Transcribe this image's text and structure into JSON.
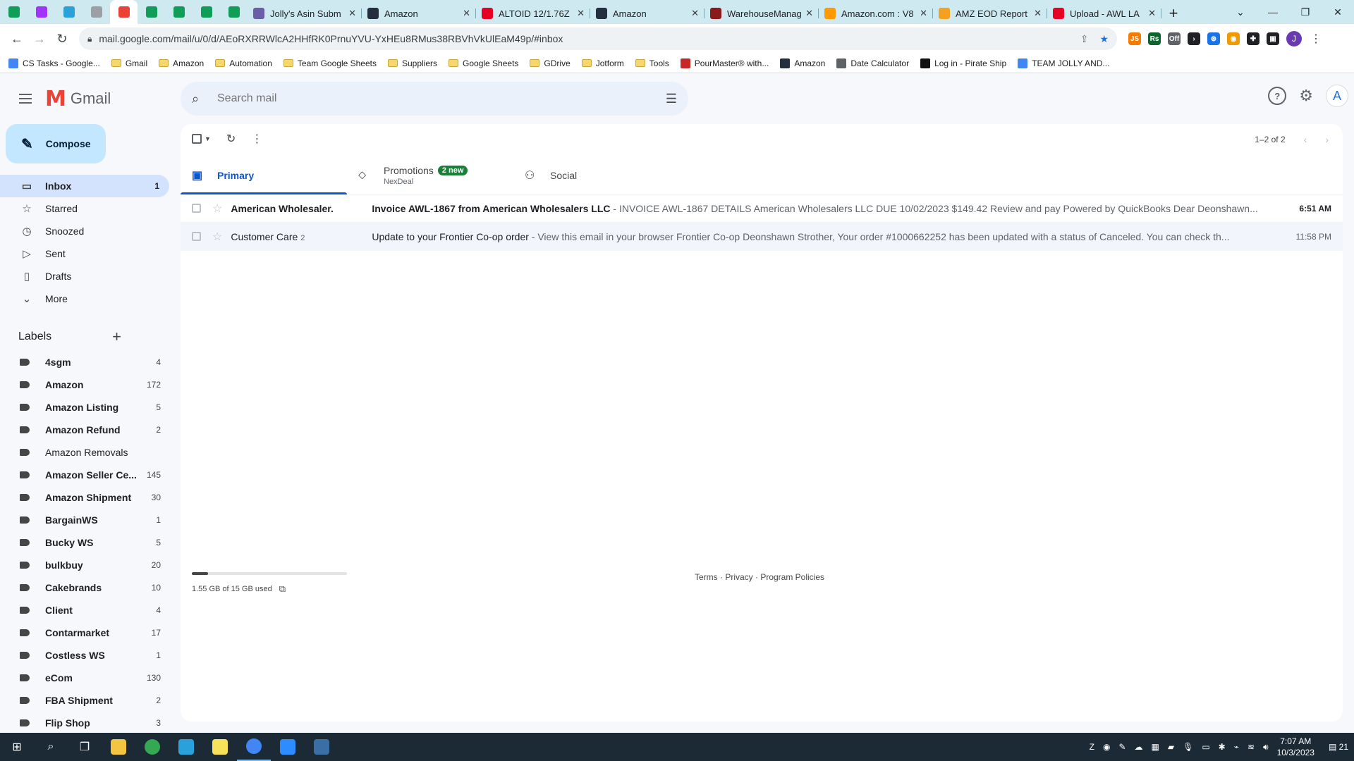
{
  "browser": {
    "pinned_tabs": [
      {
        "icon": "sheets-icon",
        "color": "#0f9d58"
      },
      {
        "icon": "messenger-icon",
        "color": "#a033ff"
      },
      {
        "icon": "telegram-icon",
        "color": "#2aa1da"
      },
      {
        "icon": "app-icon",
        "color": "#9aa0a6"
      },
      {
        "icon": "gmail-icon",
        "color": "#ea4335"
      },
      {
        "icon": "sheets-icon",
        "color": "#0f9d58"
      },
      {
        "icon": "sheets-icon",
        "color": "#0f9d58"
      },
      {
        "icon": "sheets-icon",
        "color": "#0f9d58"
      },
      {
        "icon": "sheets-icon",
        "color": "#0f9d58"
      }
    ],
    "tabs": [
      {
        "title": "Jolly's Asin Subm",
        "icon_color": "#6b5ea8"
      },
      {
        "title": "Amazon",
        "icon_color": "#232f3e"
      },
      {
        "title": "ALTOID 12/1.76Z",
        "icon_color": "#e60023"
      },
      {
        "title": "Amazon",
        "icon_color": "#232f3e"
      },
      {
        "title": "WarehouseManag",
        "icon_color": "#8b1a1a"
      },
      {
        "title": "Amazon.com : V8",
        "icon_color": "#ff9900"
      },
      {
        "title": "AMZ EOD Report",
        "icon_color": "#f4a020"
      },
      {
        "title": "Upload - AWL LA",
        "icon_color": "#e60023"
      }
    ],
    "new_tab": "+",
    "window_controls": {
      "down": "⌄",
      "minimize": "—",
      "restore": "❐",
      "close": "✕"
    },
    "url": "mail.google.com/mail/u/0/d/AEoRXRRWlcA2HHfRK0PrnuYVU-YxHEu8RMus38RBVhVkUlEaM49p/#inbox",
    "profile_initial": "J",
    "extensions": [
      {
        "label": "JS",
        "color": "#f57c00"
      },
      {
        "label": "Rs",
        "color": "#0d652d"
      },
      {
        "label": "Off",
        "color": "#5f6368"
      },
      {
        "label": "›",
        "color": "#202124"
      },
      {
        "label": "⊛",
        "color": "#1a73e8"
      },
      {
        "label": "◉",
        "color": "#f29900"
      },
      {
        "label": "✚",
        "color": "#202124"
      },
      {
        "label": "▣",
        "color": "#202124"
      }
    ],
    "bookmarks": [
      {
        "label": "CS Tasks - Google...",
        "kind": "doc",
        "color": "#4285f4"
      },
      {
        "label": "Gmail",
        "kind": "folder"
      },
      {
        "label": "Amazon",
        "kind": "folder"
      },
      {
        "label": "Automation",
        "kind": "folder"
      },
      {
        "label": "Team Google Sheets",
        "kind": "folder"
      },
      {
        "label": "Suppliers",
        "kind": "folder"
      },
      {
        "label": "Google Sheets",
        "kind": "folder"
      },
      {
        "label": "GDrive",
        "kind": "folder"
      },
      {
        "label": "Jotform",
        "kind": "folder"
      },
      {
        "label": "Tools",
        "kind": "folder"
      },
      {
        "label": "PourMaster® with...",
        "kind": "site",
        "color": "#c62828"
      },
      {
        "label": "Amazon",
        "kind": "site",
        "color": "#232f3e"
      },
      {
        "label": "Date Calculator",
        "kind": "site",
        "color": "#5f6368"
      },
      {
        "label": "Log in - Pirate Ship",
        "kind": "site",
        "color": "#111111"
      },
      {
        "label": "TEAM JOLLY AND...",
        "kind": "doc",
        "color": "#4285f4"
      }
    ]
  },
  "gmail": {
    "logo_text": "Gmail",
    "search_placeholder": "Search mail",
    "account_initial": "A",
    "compose_label": "Compose",
    "nav": [
      {
        "label": "Inbox",
        "count": "1",
        "icon": "inbox-icon",
        "glyph": "▭",
        "active": true
      },
      {
        "label": "Starred",
        "count": "",
        "icon": "star-icon",
        "glyph": "☆",
        "active": false
      },
      {
        "label": "Snoozed",
        "count": "",
        "icon": "clock-icon",
        "glyph": "◷",
        "active": false
      },
      {
        "label": "Sent",
        "count": "",
        "icon": "send-icon",
        "glyph": "▷",
        "active": false
      },
      {
        "label": "Drafts",
        "count": "",
        "icon": "draft-icon",
        "glyph": "▯",
        "active": false
      },
      {
        "label": "More",
        "count": "",
        "icon": "chevron-down-icon",
        "glyph": "⌄",
        "active": false
      }
    ],
    "labels_title": "Labels",
    "labels": [
      {
        "name": "4sgm",
        "count": "4",
        "bold": true
      },
      {
        "name": "Amazon",
        "count": "172",
        "bold": true
      },
      {
        "name": "Amazon Listing",
        "count": "5",
        "bold": true
      },
      {
        "name": "Amazon Refund",
        "count": "2",
        "bold": true
      },
      {
        "name": "Amazon Removals",
        "count": "",
        "bold": false
      },
      {
        "name": "Amazon Seller Ce...",
        "count": "145",
        "bold": true
      },
      {
        "name": "Amazon Shipment",
        "count": "30",
        "bold": true
      },
      {
        "name": "BargainWS",
        "count": "1",
        "bold": true
      },
      {
        "name": "Bucky WS",
        "count": "5",
        "bold": true
      },
      {
        "name": "bulkbuy",
        "count": "20",
        "bold": true
      },
      {
        "name": "Cakebrands",
        "count": "10",
        "bold": true
      },
      {
        "name": "Client",
        "count": "4",
        "bold": true
      },
      {
        "name": "Contarmarket",
        "count": "17",
        "bold": true
      },
      {
        "name": "Costless WS",
        "count": "1",
        "bold": true
      },
      {
        "name": "eCom",
        "count": "130",
        "bold": true
      },
      {
        "name": "FBA Shipment",
        "count": "2",
        "bold": true
      },
      {
        "name": "Flip Shop",
        "count": "3",
        "bold": true
      }
    ],
    "pager_text": "1–2 of 2",
    "tabs": [
      {
        "label": "Primary",
        "icon": "inbox-tab-icon",
        "glyph": "▣",
        "badge": "",
        "sub": "",
        "active": true
      },
      {
        "label": "Promotions",
        "icon": "tag-icon",
        "glyph": "⬦",
        "badge": "2 new",
        "sub": "NexDeal",
        "active": false
      },
      {
        "label": "Social",
        "icon": "people-icon",
        "glyph": "⚇",
        "badge": "",
        "sub": "",
        "active": false
      }
    ],
    "emails": [
      {
        "sender": "American Wholesaler.",
        "count": "",
        "subject": "Invoice AWL-1867 from American Wholesalers LLC",
        "snippet": " - INVOICE AWL-1867 DETAILS American Wholesalers LLC DUE 10/02/2023 $149.42 Review and pay Powered by QuickBooks Dear Deonshawn...",
        "time": "6:51 AM",
        "unread": true
      },
      {
        "sender": "Customer Care",
        "count": "2",
        "subject": "Update to your Frontier Co-op order",
        "snippet": " - View this email in your browser Frontier Co-op Deonshawn Strother, Your order #1000662252 has been updated with a status of Canceled. You can check th...",
        "time": "11:58 PM",
        "unread": false
      }
    ],
    "storage_text": "1.55 GB of 15 GB used",
    "storage_fraction": 0.103,
    "footer_links": "Terms · Privacy · Program Policies"
  },
  "taskbar": {
    "apps": [
      {
        "icon": "file-explorer-icon",
        "color": "#f4c542",
        "open": false
      },
      {
        "icon": "chrome-icon",
        "color": "#34a853",
        "open": false
      },
      {
        "icon": "telegram-desktop-icon",
        "color": "#2aa1da",
        "open": false
      },
      {
        "icon": "sticky-notes-icon",
        "color": "#f7e05a",
        "open": false
      },
      {
        "icon": "chrome-profile-icon",
        "color": "#4285f4",
        "open": true
      },
      {
        "icon": "zoom-icon",
        "color": "#2d8cff",
        "open": false
      },
      {
        "icon": "calculator-icon",
        "color": "#3a6ea5",
        "open": false
      }
    ],
    "time": "7:07 AM",
    "date": "10/3/2023",
    "notification_count": "21"
  }
}
